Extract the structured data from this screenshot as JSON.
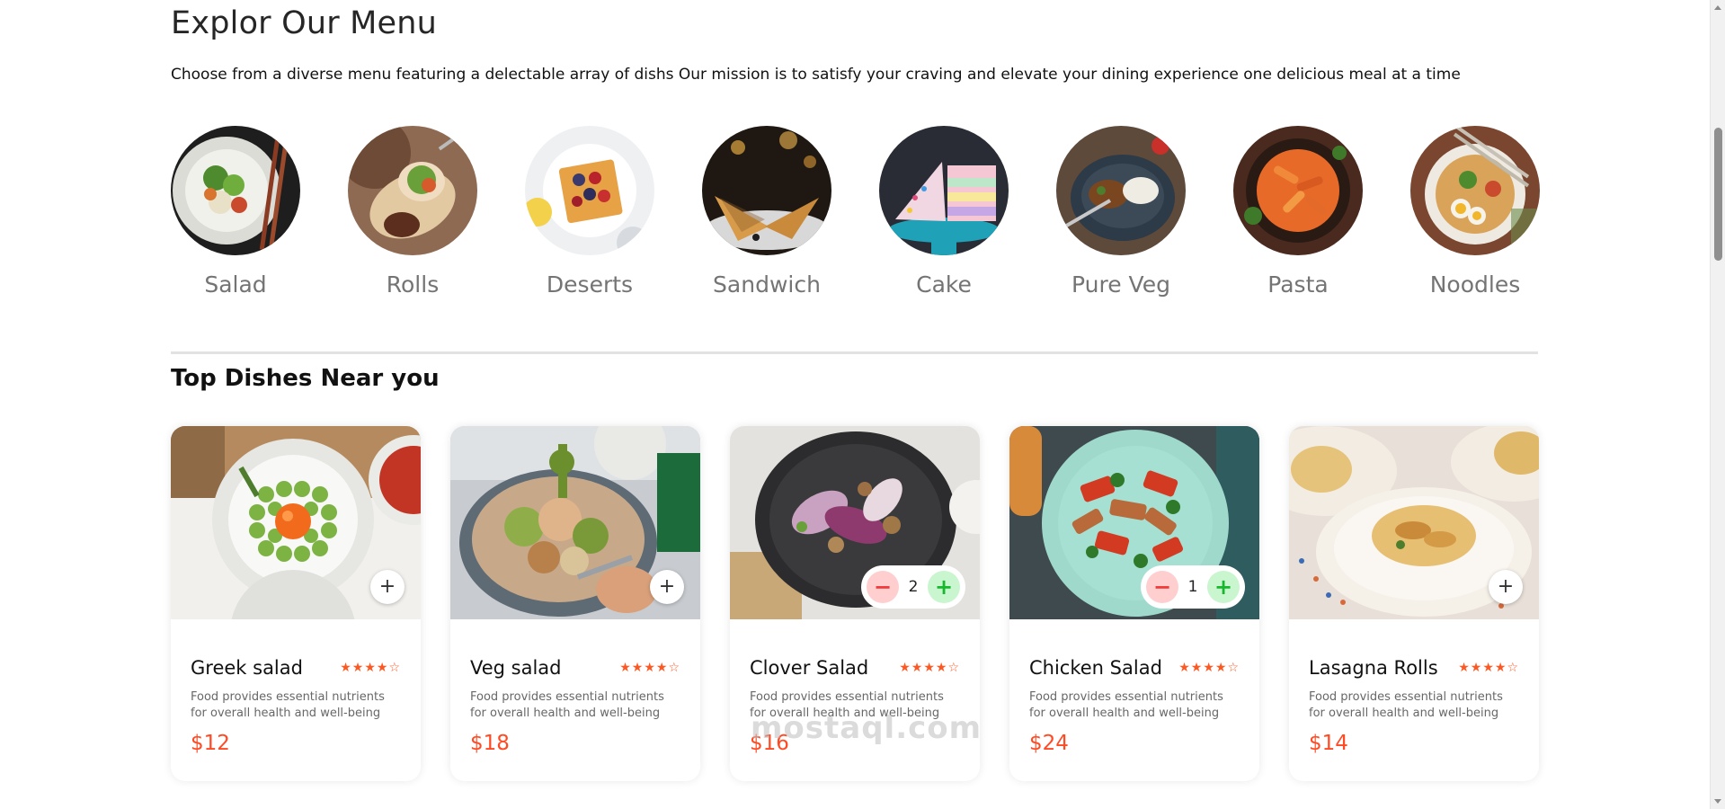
{
  "menu": {
    "title": "Explor Our Menu",
    "description": "Choose from a diverse menu featuring a delectable array of dishs Our mission is to satisfy your craving and elevate your dining experience one delicious meal at a time",
    "categories": [
      {
        "label": "Salad"
      },
      {
        "label": "Rolls"
      },
      {
        "label": "Deserts"
      },
      {
        "label": "Sandwich"
      },
      {
        "label": "Cake"
      },
      {
        "label": "Pure Veg"
      },
      {
        "label": "Pasta"
      },
      {
        "label": "Noodles"
      }
    ]
  },
  "top_dishes": {
    "title": "Top Dishes Near you",
    "items": [
      {
        "name": "Greek salad",
        "stars": "★★★★☆",
        "rating": 4,
        "description": "Food provides essential nutrients for overall health and well-being",
        "price": "$12",
        "add_icon": "+"
      },
      {
        "name": "Veg salad",
        "stars": "★★★★☆",
        "rating": 4,
        "description": "Food provides essential nutrients for overall health and well-being",
        "price": "$18",
        "add_icon": "+"
      },
      {
        "name": "Clover Salad",
        "stars": "★★★★☆",
        "rating": 4,
        "description": "Food provides essential nutrients for overall health and well-being",
        "price": "$16",
        "quantity": "2",
        "minus_icon": "−",
        "plus_icon": "+"
      },
      {
        "name": "Chicken Salad",
        "stars": "★★★★☆",
        "rating": 4,
        "description": "Food provides essential nutrients for overall health and well-being",
        "price": "$24",
        "quantity": "1",
        "minus_icon": "−",
        "plus_icon": "+"
      },
      {
        "name": "Lasagna Rolls",
        "stars": "★★★★☆",
        "rating": 4,
        "description": "Food provides essential nutrients for overall health and well-being",
        "price": "$14",
        "add_icon": "+"
      }
    ]
  },
  "watermark": "mostaql.com",
  "colors": {
    "accent": "#ff4a24",
    "stars": "#ff5722",
    "minus_bg": "#ffcfcf",
    "plus_bg": "#c9f5cf"
  }
}
